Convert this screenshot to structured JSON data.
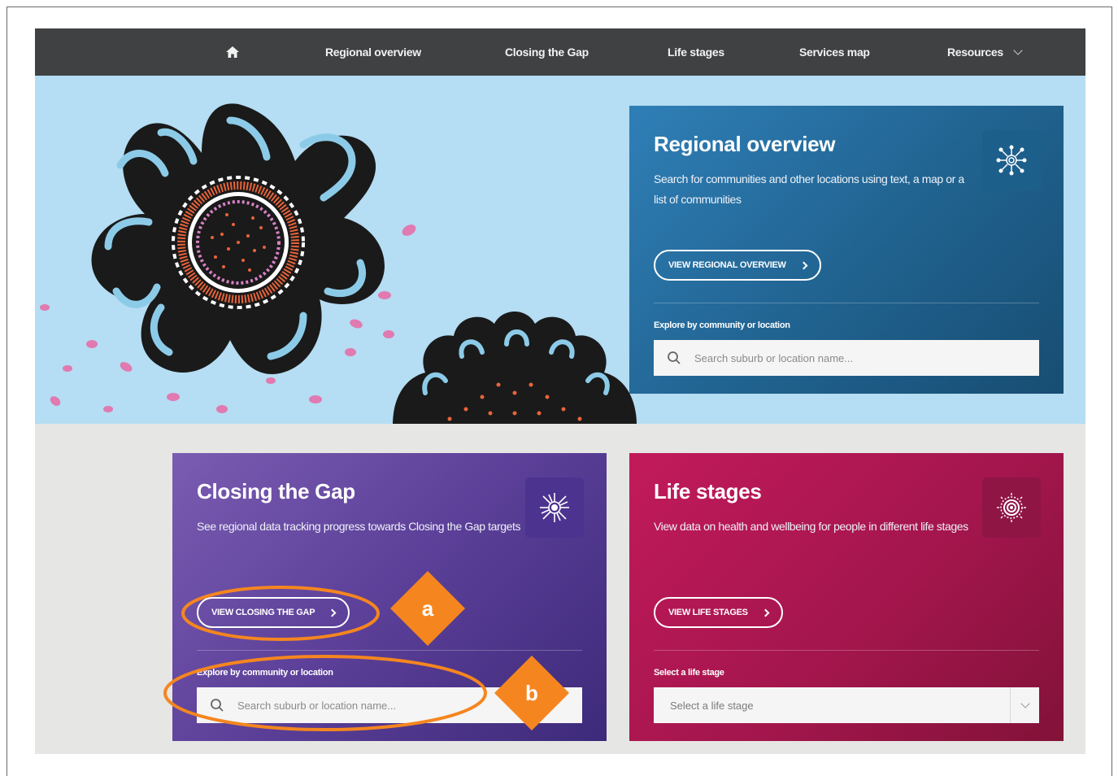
{
  "nav": {
    "home_icon": "home-icon",
    "items": [
      {
        "label": "Regional overview"
      },
      {
        "label": "Closing the Gap"
      },
      {
        "label": "Life stages"
      },
      {
        "label": "Services map"
      },
      {
        "label": "Resources"
      }
    ]
  },
  "cards": {
    "regional": {
      "title": "Regional overview",
      "description": "Search for communities and other locations using text, a map or a list of communities",
      "button_label": "VIEW REGIONAL OVERVIEW",
      "field_label": "Explore by community or location",
      "search_placeholder": "Search suburb or location name...",
      "icon": "network-icon"
    },
    "closing_gap": {
      "title": "Closing the Gap",
      "description": "See regional data tracking progress towards Closing the Gap targets",
      "button_label": "VIEW CLOSING THE GAP",
      "field_label": "Explore by community or location",
      "search_placeholder": "Search suburb or location name...",
      "icon": "burst-icon"
    },
    "life_stages": {
      "title": "Life stages",
      "description": "View data on health and wellbeing for people in different life stages",
      "button_label": "VIEW LIFE STAGES",
      "field_label": "Select a life stage",
      "select_value": "Select a life stage",
      "icon": "concentric-circle-icon"
    }
  },
  "annotations": {
    "a": "a",
    "b": "b"
  },
  "colors": {
    "nav_bg": "#3f4142",
    "hero_bg": "#b5ddf3",
    "regional_card": "#20628f",
    "closing_gap_card": "#5b3f98",
    "life_stages_card": "#a4164d",
    "annotation_orange": "#f5861f"
  }
}
